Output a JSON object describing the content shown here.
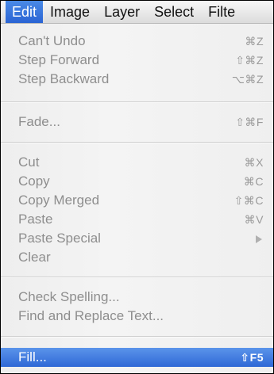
{
  "menubar": {
    "items": [
      {
        "label": "Edit",
        "active": true
      },
      {
        "label": "Image"
      },
      {
        "label": "Layer"
      },
      {
        "label": "Select"
      },
      {
        "label": "Filte"
      }
    ]
  },
  "menu": {
    "undo_group": [
      {
        "label": "Can't Undo",
        "shortcut": "⌘Z"
      },
      {
        "label": "Step Forward",
        "shortcut": "⇧⌘Z"
      },
      {
        "label": "Step Backward",
        "shortcut": "⌥⌘Z"
      }
    ],
    "fade_group": [
      {
        "label": "Fade...",
        "shortcut": "⇧⌘F"
      }
    ],
    "clipboard_group": [
      {
        "label": "Cut",
        "shortcut": "⌘X"
      },
      {
        "label": "Copy",
        "shortcut": "⌘C"
      },
      {
        "label": "Copy Merged",
        "shortcut": "⇧⌘C"
      },
      {
        "label": "Paste",
        "shortcut": "⌘V"
      },
      {
        "label": "Paste Special",
        "shortcut": ""
      },
      {
        "label": "Clear",
        "shortcut": ""
      }
    ],
    "text_group": [
      {
        "label": "Check Spelling...",
        "shortcut": ""
      },
      {
        "label": "Find and Replace Text...",
        "shortcut": ""
      }
    ],
    "fill_group": [
      {
        "label": "Fill...",
        "shortcut": "⇧F5"
      }
    ]
  },
  "colors": {
    "highlight": "#2f68d6",
    "disabled_text": "#8e8e8e"
  }
}
